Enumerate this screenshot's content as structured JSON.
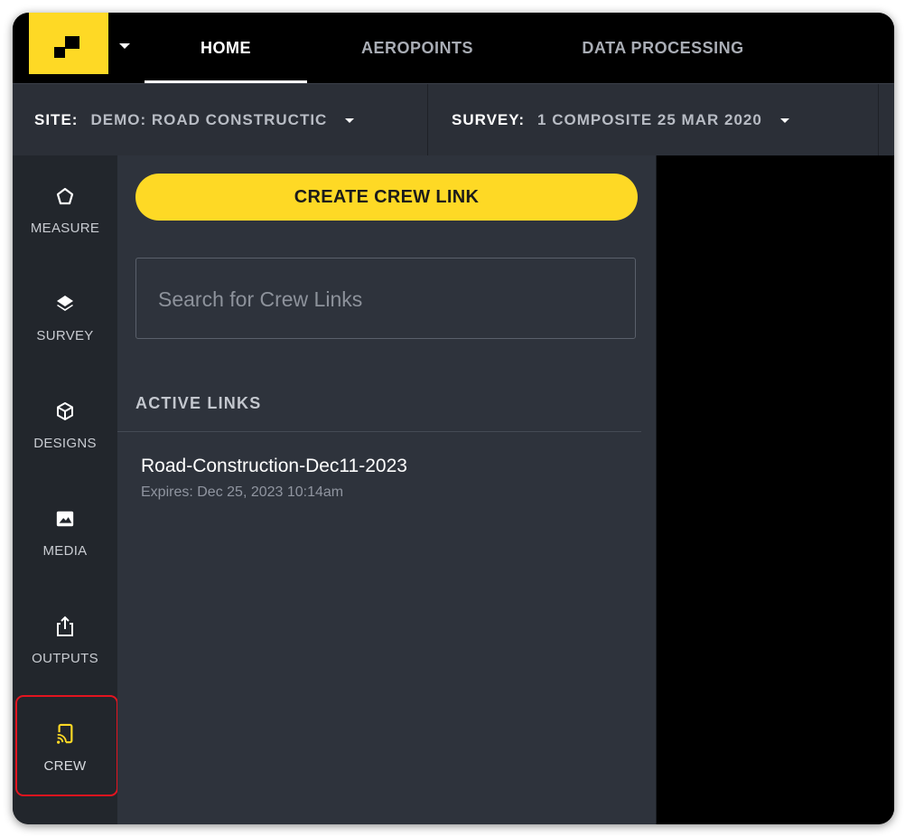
{
  "nav": {
    "tabs": [
      {
        "label": "HOME",
        "active": true
      },
      {
        "label": "AEROPOINTS",
        "active": false
      },
      {
        "label": "DATA PROCESSING",
        "active": false
      }
    ],
    "menu_icon": "chevron-down-icon"
  },
  "site": {
    "label": "SITE:",
    "value": "DEMO: ROAD CONSTRUCTIC"
  },
  "survey": {
    "label": "SURVEY:",
    "value": "1 COMPOSITE 25 MAR 2020"
  },
  "rail": {
    "items": [
      {
        "label": "MEASURE",
        "icon": "pentagon-icon"
      },
      {
        "label": "SURVEY",
        "icon": "layers-icon"
      },
      {
        "label": "DESIGNS",
        "icon": "cube-icon"
      },
      {
        "label": "MEDIA",
        "icon": "image-icon"
      },
      {
        "label": "OUTPUTS",
        "icon": "share-icon"
      },
      {
        "label": "CREW",
        "icon": "cast-icon",
        "active": true
      }
    ]
  },
  "panel": {
    "create_button": "CREATE CREW LINK",
    "search": {
      "placeholder": "Search for Crew Links",
      "value": ""
    },
    "section_title": "ACTIVE LINKS",
    "links": [
      {
        "name": "Road-Construction-Dec11-2023",
        "expires": "Expires: Dec 25, 2023 10:14am"
      }
    ]
  },
  "colors": {
    "accent": "#fed925",
    "highlight": "#e3141f",
    "panel_bg": "#2e333c",
    "rail_bg": "#22262c"
  }
}
